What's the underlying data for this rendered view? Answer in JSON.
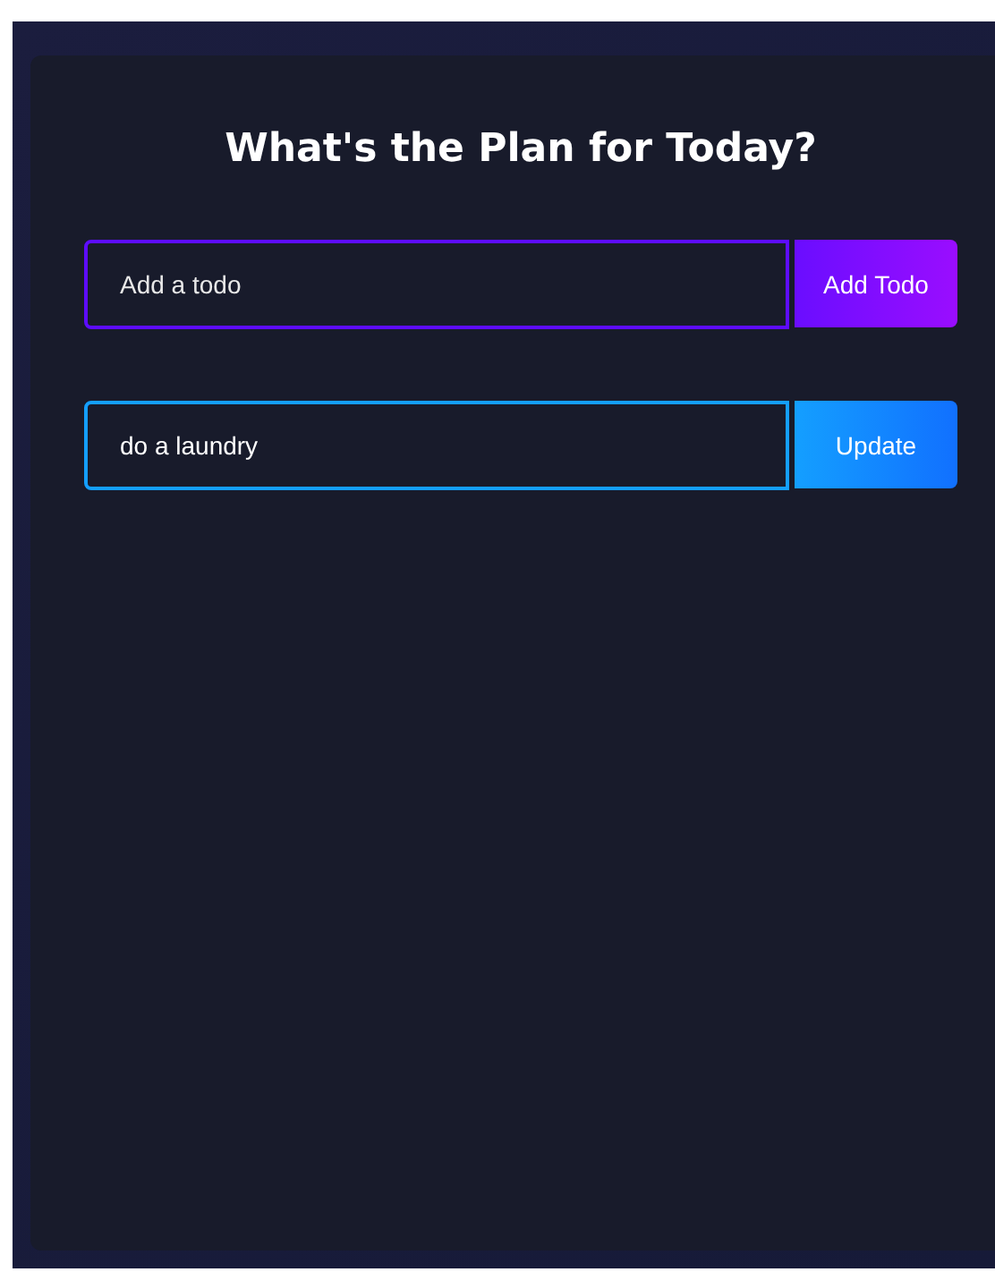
{
  "title": "What's the Plan for Today?",
  "forms": [
    {
      "kind": "add",
      "placeholder": "Add a todo",
      "button": "Add Todo"
    },
    {
      "kind": "edit",
      "value": "do a laundry",
      "button": "Update"
    }
  ]
}
